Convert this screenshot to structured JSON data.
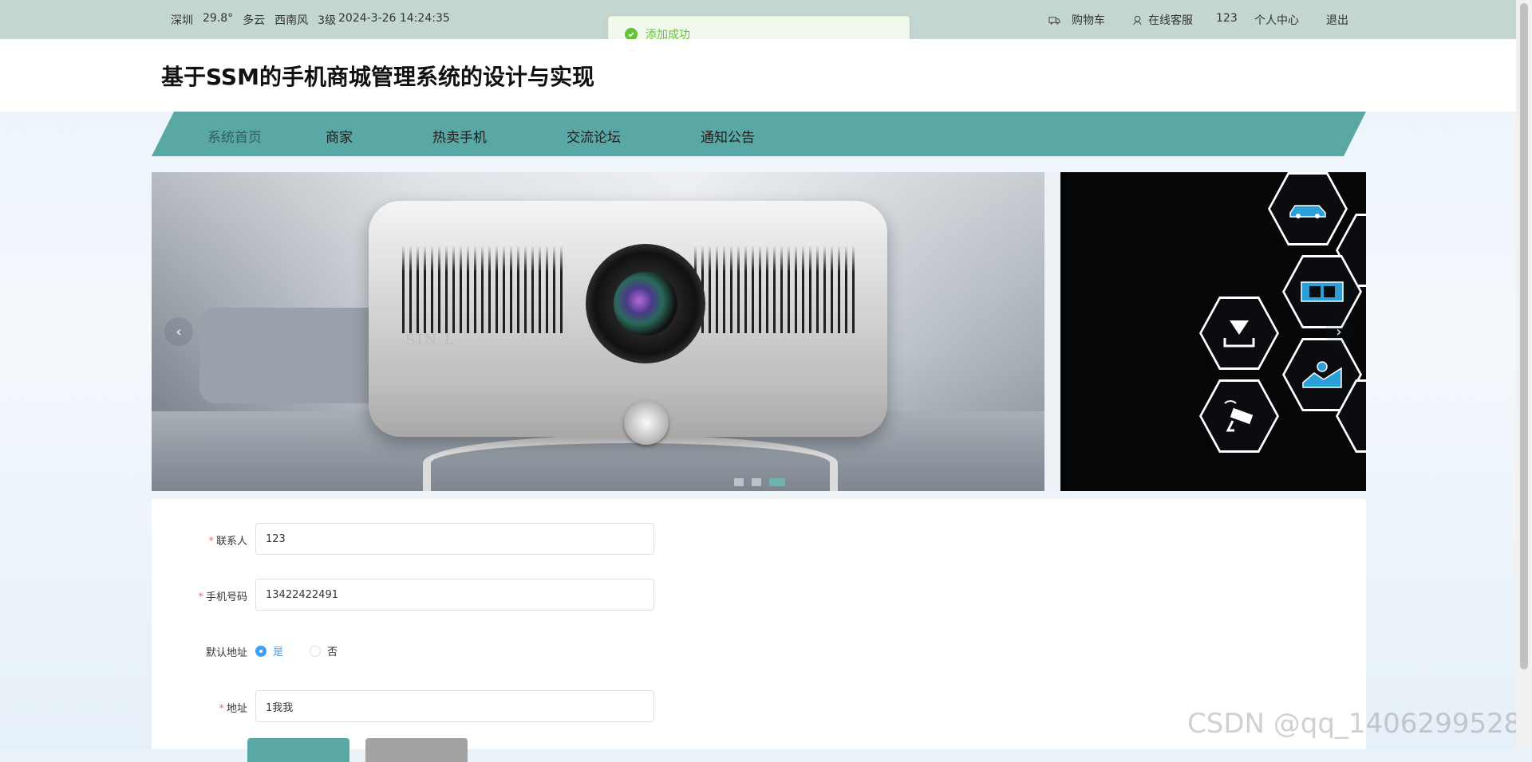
{
  "topbar": {
    "weather": {
      "city": "深圳",
      "temp": "29.8°",
      "condition": "多云",
      "wind": "西南风",
      "wind_level": "3级"
    },
    "datetime": "2024-3-26 14:24:35",
    "cart_label": "购物车",
    "service_label": "在线客服",
    "username": "123",
    "profile_label": "个人中心",
    "logout_label": "退出"
  },
  "toast": {
    "message": "添加成功"
  },
  "header": {
    "title": "基于SSM的手机商城管理系统的设计与实现"
  },
  "nav": {
    "items": [
      {
        "label": "系统首页"
      },
      {
        "label": "商家"
      },
      {
        "label": "热卖手机"
      },
      {
        "label": "交流论坛"
      },
      {
        "label": "通知公告"
      }
    ]
  },
  "carousel": {
    "brand_text": "SIN L",
    "prev_label": "‹",
    "next_label": "›",
    "slide_count": 3,
    "active_index": 2
  },
  "form": {
    "contact": {
      "label": "联系人",
      "value": "123"
    },
    "phone": {
      "label": "手机号码",
      "value": "13422422491"
    },
    "default_address": {
      "label": "默认地址",
      "options": [
        "是",
        "否"
      ],
      "selected": "是"
    },
    "address": {
      "label": "地址",
      "value": "1我我"
    }
  },
  "watermark": "CSDN @qq_1406299528",
  "colors": {
    "topbar": "#c4d6d1",
    "nav": "#5aa8a5",
    "success": "#67c23a",
    "radio_active": "#409eff",
    "primary_button": "#5aa8a5"
  }
}
